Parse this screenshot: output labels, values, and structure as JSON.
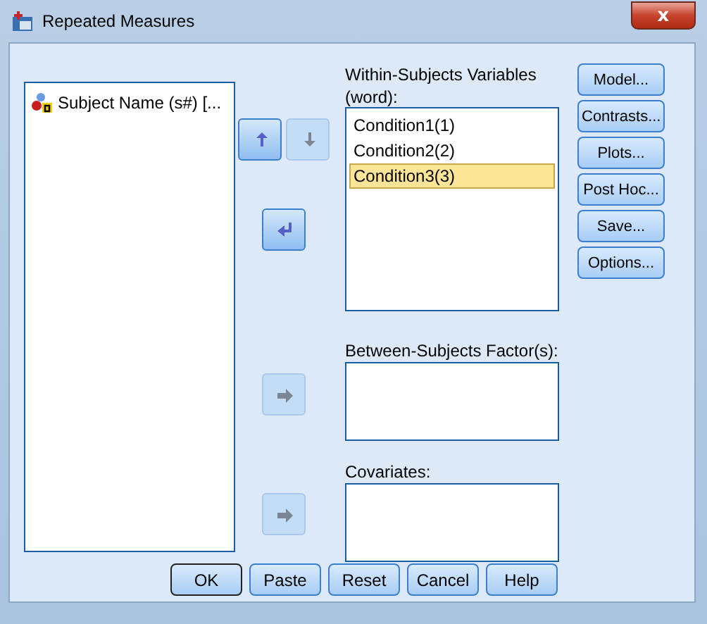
{
  "window": {
    "title": "Repeated Measures",
    "close": "x"
  },
  "variables": [
    {
      "name": "Subject Name (s#) [..."
    }
  ],
  "move_buttons": [
    {
      "kind": "up",
      "disabled": false
    },
    {
      "kind": "down",
      "disabled": true
    },
    {
      "kind": "enter",
      "disabled": false
    },
    {
      "kind": "right",
      "disabled": true
    },
    {
      "kind": "right",
      "disabled": true
    }
  ],
  "within": {
    "label": "Within-Subjects Variables (word):",
    "items": [
      {
        "name": "Condition1(1)",
        "selected": false
      },
      {
        "name": "Condition2(2)",
        "selected": false
      },
      {
        "name": "Condition3(3)",
        "selected": true
      }
    ]
  },
  "between": {
    "label": "Between-Subjects Factor(s):"
  },
  "covariates": {
    "label": "Covariates:"
  },
  "side_buttons": [
    "Model...",
    "Contrasts...",
    "Plots...",
    "Post Hoc...",
    "Save...",
    "Options..."
  ],
  "bottom_buttons": [
    {
      "label": "OK",
      "default": true
    },
    {
      "label": "Paste",
      "default": false
    },
    {
      "label": "Reset",
      "default": false
    },
    {
      "label": "Cancel",
      "default": false
    },
    {
      "label": "Help",
      "default": false
    }
  ]
}
